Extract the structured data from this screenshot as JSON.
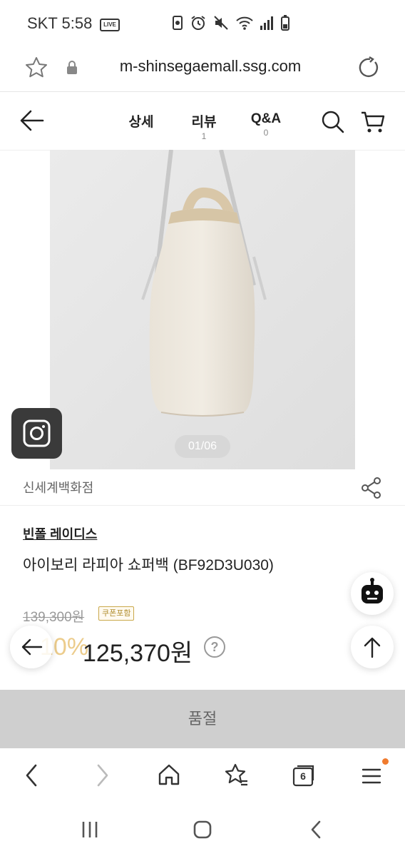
{
  "status": {
    "carrier_time": "SKT 5:58",
    "live_badge": "LIVE"
  },
  "browser": {
    "url": "m-shinsegaemall.ssg.com",
    "tab_count": "6"
  },
  "nav": {
    "tabs": [
      {
        "label": "상세",
        "count": ""
      },
      {
        "label": "리뷰",
        "count": "1"
      },
      {
        "label": "Q&A",
        "count": "0"
      }
    ]
  },
  "gallery": {
    "pager": "01/06"
  },
  "product": {
    "store": "신세계백화점",
    "brand": "빈폴 레이디스",
    "name": "아이보리 라피아 쇼퍼백 (BF92D3U030)",
    "original_price": "139,300원",
    "coupon_badge": "쿠폰포함",
    "discount": "10%",
    "price": "125,370원",
    "help": "?"
  },
  "cta": {
    "soldout_label": "품절"
  }
}
